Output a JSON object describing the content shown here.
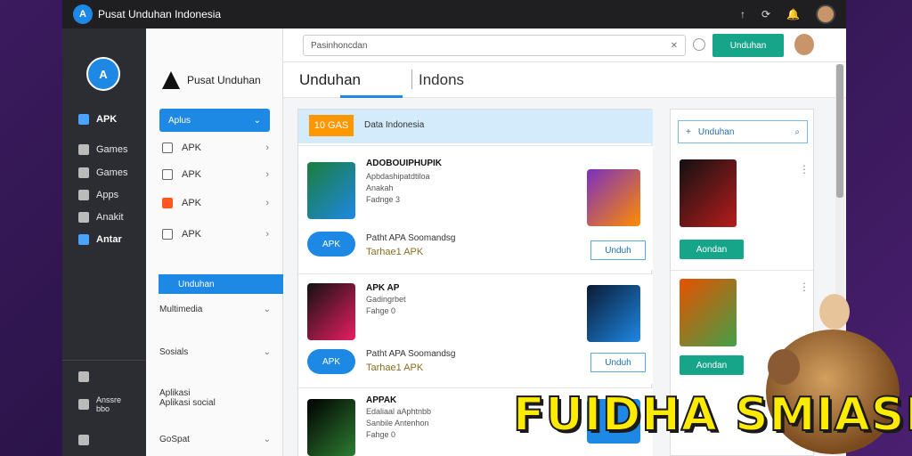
{
  "topbar": {
    "logo": "A",
    "title": "Pusat Unduhan Indonesia",
    "icons": [
      "arrow-icon",
      "refresh-icon",
      "notification-icon"
    ]
  },
  "sidebar": {
    "brand": "A",
    "items": [
      {
        "label": "APK",
        "icon": "home-icon",
        "active": true
      },
      {
        "label": "Games",
        "icon": "game-icon"
      },
      {
        "label": "Games",
        "icon": "box-icon"
      },
      {
        "label": "Apps",
        "icon": "apps-icon"
      },
      {
        "label": "Anakit",
        "icon": "kit-icon"
      },
      {
        "label": "Antar",
        "icon": "image-icon",
        "active": true
      }
    ],
    "bottom": [
      {
        "label": "",
        "icon": "shield-icon"
      },
      {
        "label": "Anssre\nbbo",
        "icon": "info-icon"
      },
      {
        "label": "",
        "icon": "settings-icon"
      }
    ]
  },
  "subnav": {
    "title": "Pusat Unduhan",
    "primary_button": "Aplus",
    "items": [
      {
        "label": "APK",
        "icon": "shield-icon"
      },
      {
        "label": "APK",
        "icon": "tag-icon"
      },
      {
        "label": "APK",
        "icon": "orange-icon"
      },
      {
        "label": "APK",
        "icon": "list-icon"
      }
    ],
    "highlight": "Unduhan",
    "sections": [
      "Multimedia",
      "Sosials",
      "Aplikasi\nAplikasi social",
      "GoSpat"
    ]
  },
  "main": {
    "search_placeholder": "Pasinhoncdan",
    "search_button": "Unduhan",
    "tab1": "Unduhan",
    "tab2": "Indons",
    "list_header_badge": "10 GAS",
    "list_header_label": "Data Indonesia",
    "cards": [
      {
        "name": "ADOBOUIPHUPIK",
        "meta": [
          "Apbdashipatdtiloa",
          "Anakah",
          "Fadnge 3"
        ],
        "row_label": "Patht APA Soomandsg",
        "row_sub": "Tarhae1 APK",
        "small_icon": "APK",
        "button": "Unduh"
      },
      {
        "name": "APK AP",
        "meta": [
          "Gadingrbet",
          "Fahge 0"
        ],
        "row_label": "Patht APA Soomandsg",
        "row_sub": "Tarhae1 APK",
        "small_icon": "APK",
        "button": "Unduh"
      },
      {
        "name": "APPAK",
        "meta": [
          "Edaliaal aAphtnbb",
          "Sanbile Antenhon",
          "Fahge 0"
        ],
        "row_label": "",
        "row_sub": "",
        "small_icon": "",
        "button": ""
      }
    ]
  },
  "rightpanel": {
    "search_label": "Unduhan",
    "items": [
      {
        "button": "Aondan"
      },
      {
        "button": "Aondan"
      }
    ]
  },
  "promo": {
    "text": "FUIDHA SMIASIS"
  }
}
